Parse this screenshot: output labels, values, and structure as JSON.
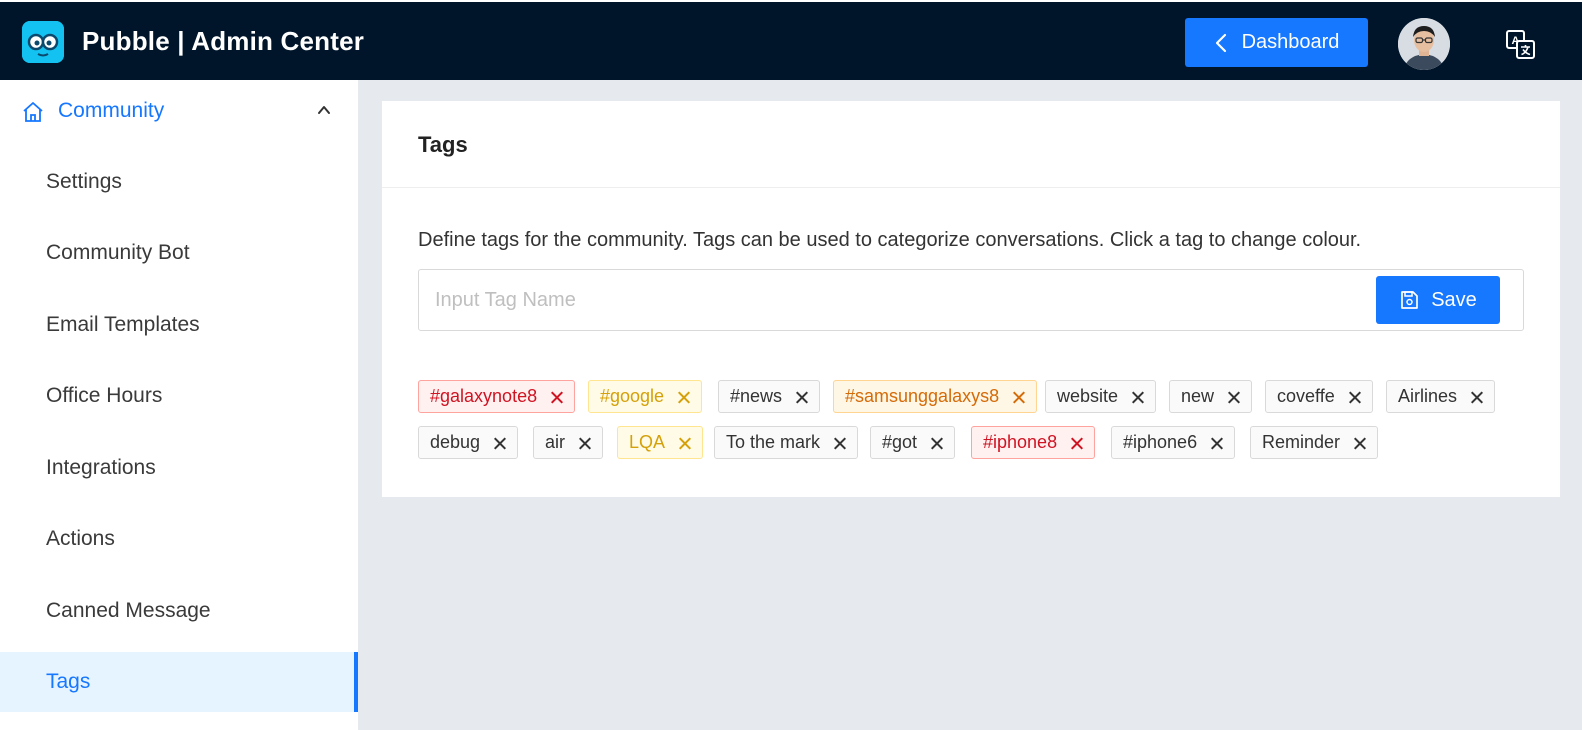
{
  "header": {
    "title": "Pubble | Admin Center",
    "dashboard_label": "Dashboard"
  },
  "sidebar": {
    "group_label": "Community",
    "items": [
      {
        "label": "Settings"
      },
      {
        "label": "Community Bot"
      },
      {
        "label": "Email Templates"
      },
      {
        "label": "Office Hours"
      },
      {
        "label": "Integrations"
      },
      {
        "label": "Actions"
      },
      {
        "label": "Canned Message"
      },
      {
        "label": "Tags",
        "active": true
      }
    ]
  },
  "main": {
    "title": "Tags",
    "description": "Define tags for the community. Tags can be used to categorize conversations. Click a tag to change colour.",
    "input_placeholder": "Input Tag Name",
    "input_value": "",
    "save_label": "Save",
    "tags": [
      {
        "label": "#galaxynote8",
        "color": "red"
      },
      {
        "label": "#google",
        "color": "gold"
      },
      {
        "label": "#news",
        "color": "default"
      },
      {
        "label": "#samsunggalaxys8",
        "color": "orange"
      },
      {
        "label": "website",
        "color": "default"
      },
      {
        "label": "new",
        "color": "default"
      },
      {
        "label": "coveffe",
        "color": "default"
      },
      {
        "label": "Airlines",
        "color": "default"
      },
      {
        "label": "debug",
        "color": "default"
      },
      {
        "label": "air",
        "color": "default"
      },
      {
        "label": "LQA",
        "color": "gold"
      },
      {
        "label": "To the mark",
        "color": "default"
      },
      {
        "label": "#got",
        "color": "default"
      },
      {
        "label": "#iphone8",
        "color": "red"
      },
      {
        "label": "#iphone6",
        "color": "default"
      },
      {
        "label": "Reminder",
        "color": "default"
      }
    ]
  },
  "colors": {
    "header_bg": "#001529",
    "primary": "#1677ff",
    "page_bg": "#e6e9ee",
    "logo_bg": "#13c2f0"
  },
  "icons": {
    "logo": "owl-glasses-logo",
    "dashboard": "chevron-left-icon",
    "translate": "translate-icon",
    "community": "home-icon",
    "collapse": "chevron-up-icon",
    "save": "save-icon",
    "tag_close": "close-icon"
  }
}
